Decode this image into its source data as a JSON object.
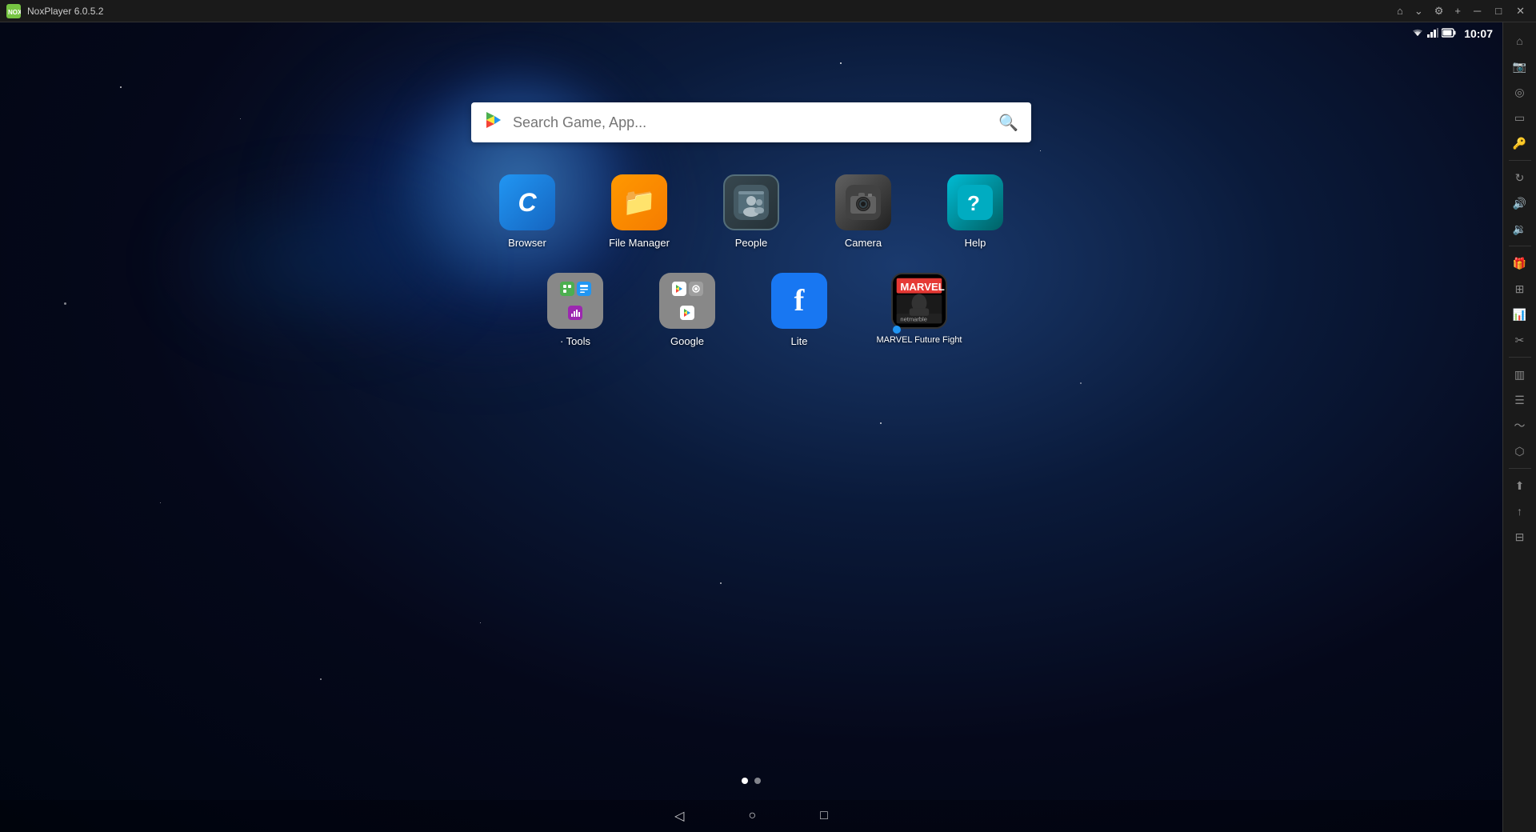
{
  "titlebar": {
    "title": "NoxPlayer 6.0.5.2",
    "logo_text": "NOX",
    "icons": [
      "home",
      "chevron-down",
      "settings",
      "add",
      "minimize",
      "maximize",
      "close"
    ]
  },
  "status_bar": {
    "time": "10:07",
    "wifi_icon": "wifi",
    "signal_icon": "signal",
    "battery_icon": "battery"
  },
  "search": {
    "placeholder": "Search Game, App..."
  },
  "apps_row1": [
    {
      "id": "browser",
      "label": "Browser",
      "icon_type": "browser"
    },
    {
      "id": "file-manager",
      "label": "File Manager",
      "icon_type": "filemanager"
    },
    {
      "id": "people",
      "label": "People",
      "icon_type": "people"
    },
    {
      "id": "camera",
      "label": "Camera",
      "icon_type": "camera"
    },
    {
      "id": "help",
      "label": "Help",
      "icon_type": "help"
    }
  ],
  "apps_row2": [
    {
      "id": "tools",
      "label": "· Tools",
      "icon_type": "tools"
    },
    {
      "id": "google",
      "label": "Google",
      "icon_type": "google"
    },
    {
      "id": "lite",
      "label": "Lite",
      "icon_type": "lite"
    },
    {
      "id": "marvel",
      "label": "MARVEL Future Fight",
      "icon_type": "marvel"
    }
  ],
  "sidebar_icons": [
    "home",
    "camera",
    "location",
    "screen",
    "key",
    "rotate",
    "volume-up",
    "volume-down",
    "gift",
    "grid",
    "chart-bar",
    "scissors",
    "bar-chart",
    "menu",
    "shake",
    "cpu",
    "capture",
    "share",
    "up-arrow",
    "grid2"
  ],
  "nav": {
    "back": "◁",
    "home": "○",
    "recent": "□"
  },
  "page_indicator": {
    "dots": [
      true,
      false
    ]
  }
}
